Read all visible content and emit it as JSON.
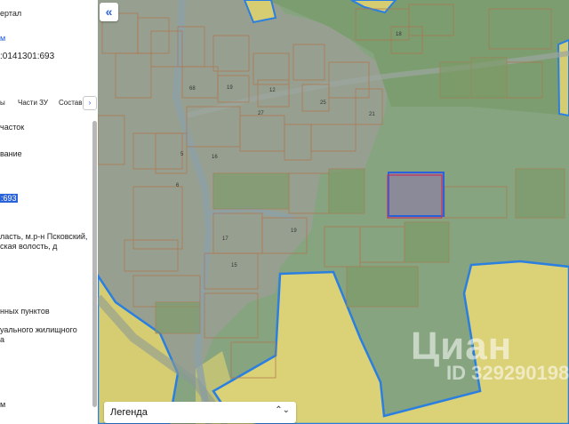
{
  "panel": {
    "portal_label": "ертал",
    "link_label": "м",
    "cadastral_number": ":0141301:693",
    "tabs": [
      "ы",
      "Части ЗУ",
      "Состав"
    ],
    "next_tab_glyph": "›",
    "type_value": "часток",
    "name_value": "вание",
    "highlighted_number": ":693",
    "address_line1": "ласть, м.р-н Псковский,",
    "address_line2": "ская волость, д",
    "category_value": "нных пунктов",
    "use_line1": "уального жилищного",
    "use_line2": "а",
    "unit": "м"
  },
  "map": {
    "collapse_glyph": "«",
    "legend_label": "Легенда",
    "legend_chevron": "⌃⌄",
    "watermark_logo": "Циан",
    "watermark_id": "ID 329290198",
    "plot_labels": [
      "18",
      "68",
      "19",
      "12",
      "25",
      "27",
      "21",
      "5",
      "17",
      "19",
      "16",
      "15",
      "6"
    ]
  },
  "colors": {
    "parcel_fill": "#8a8a99",
    "parcel_outline": "#2a62d9",
    "selected_outline": "#c8305a",
    "zone_yellow": "#d9cf6e",
    "zone_green": "#7fa273",
    "zone_border": "#2a7fe0"
  }
}
